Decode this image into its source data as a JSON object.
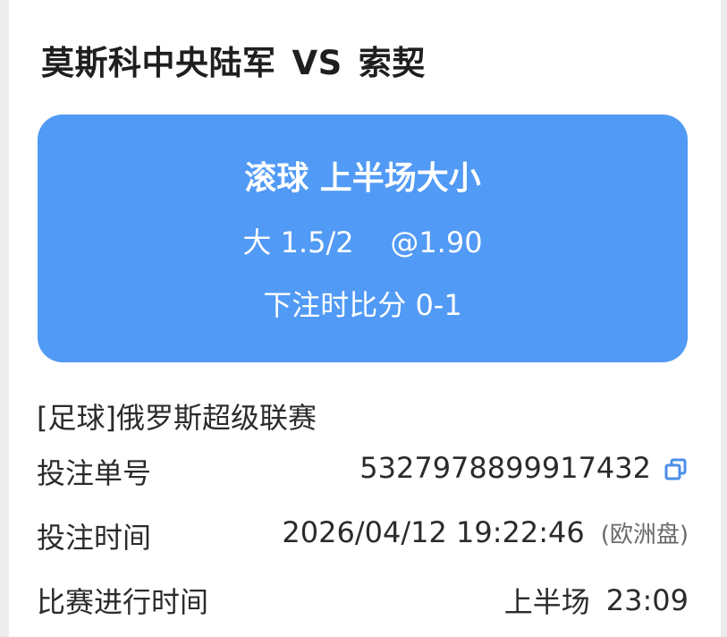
{
  "match": {
    "home": "莫斯科中央陆军",
    "vs": "VS",
    "away": "索契"
  },
  "bet": {
    "type": "滚球 上半场大小",
    "selection": "大 1.5/2    @1.90",
    "score": "下注时比分 0-1"
  },
  "league": "[足球]俄罗斯超级联赛",
  "details": {
    "order": {
      "label": "投注单号",
      "value": "5327978899917432",
      "icon": "copy-icon"
    },
    "time": {
      "label": "投注时间",
      "value": "2026/04/12 19:22:46",
      "note": "(欧洲盘)"
    },
    "elapsed": {
      "label": "比赛进行时间",
      "half": "上半场",
      "clock": "23:09"
    }
  },
  "colors": {
    "accent": "#519af5",
    "icon": "#4a8fe8",
    "text": "#2b2b2b"
  }
}
